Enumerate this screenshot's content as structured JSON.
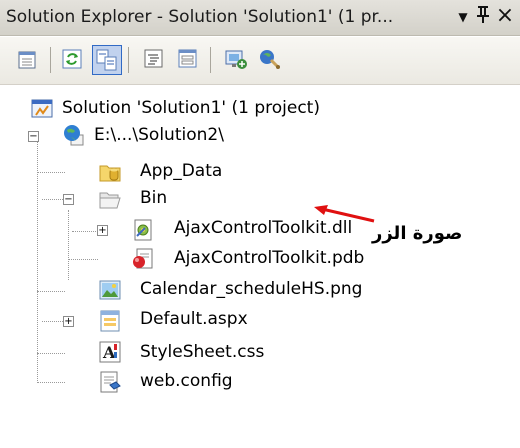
{
  "window": {
    "title": "Solution Explorer - Solution 'Solution1' (1 pr...",
    "dropdown_glyph": "▼",
    "pin_glyph": "ᚹ",
    "close_glyph": "×"
  },
  "toolbar": {
    "buttons": [
      "properties",
      "refresh",
      "nest-related-files",
      "view-code",
      "view-designer",
      "copy-website",
      "aspnet-configuration"
    ]
  },
  "tree": {
    "solution": "Solution 'Solution1' (1 project)",
    "project": "E:\\...\\Solution2\\",
    "app_data": "App_Data",
    "bin": "Bin",
    "dll": "AjaxControlToolkit.dll",
    "pdb": "AjaxControlToolkit.pdb",
    "png": "Calendar_scheduleHS.png",
    "default": "Default.aspx",
    "css": "StyleSheet.css",
    "config": "web.config"
  },
  "annotation": {
    "text": "صورة الزر",
    "color": "#e01010"
  }
}
